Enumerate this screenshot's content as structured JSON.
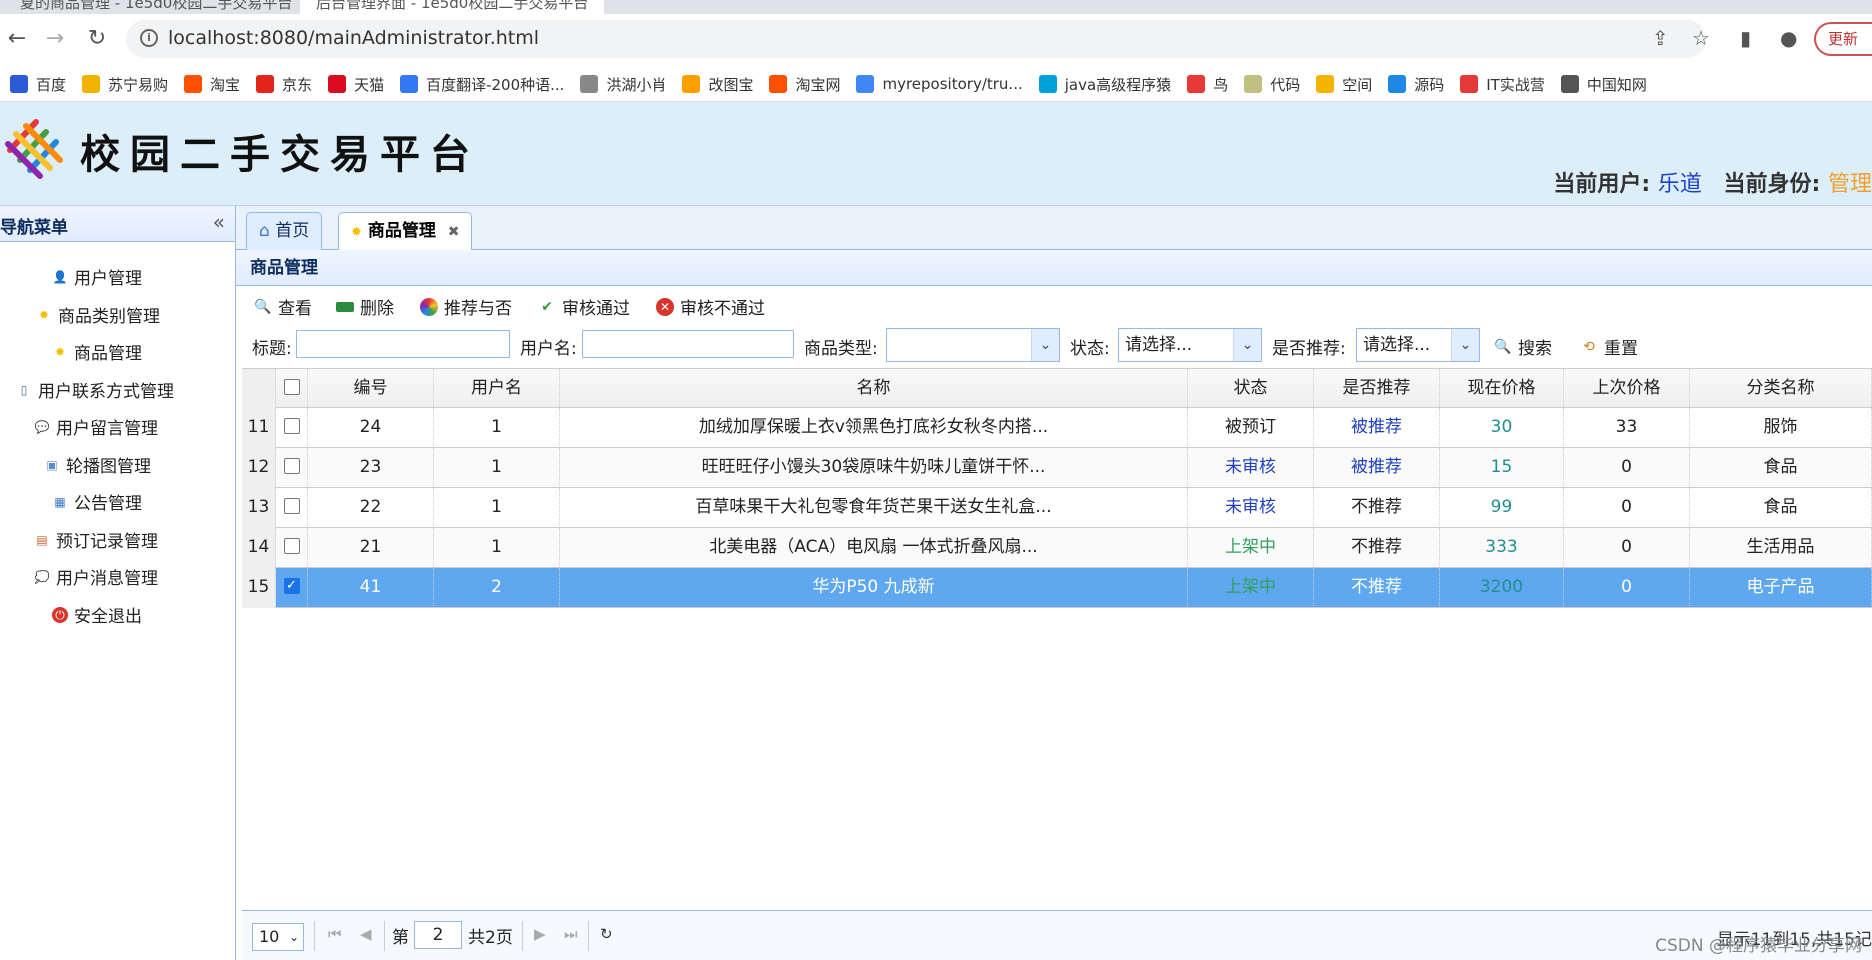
{
  "browser": {
    "tabs": [
      {
        "label": "夏的商品管理 - 1e5d0校园二手交易平台"
      },
      {
        "label": "后台管理界面 - 1e5d0校园二手交易平台"
      }
    ],
    "url": "localhost:8080/mainAdministrator.html",
    "update_label": "更新",
    "bookmarks": [
      {
        "label": "百度",
        "color": "#2b5bd7"
      },
      {
        "label": "苏宁易购",
        "color": "#f0b400"
      },
      {
        "label": "淘宝",
        "color": "#ff5000"
      },
      {
        "label": "京东",
        "color": "#e1251b"
      },
      {
        "label": "天猫",
        "color": "#d90d1f"
      },
      {
        "label": "百度翻译-200种语...",
        "color": "#3478f6"
      },
      {
        "label": "洪湖小肖",
        "color": "#888888"
      },
      {
        "label": "改图宝",
        "color": "#ffa000"
      },
      {
        "label": "淘宝网",
        "color": "#ff5000"
      },
      {
        "label": "myrepository/tru...",
        "color": "#4285f4"
      },
      {
        "label": "java高级程序猿",
        "color": "#00a1d6"
      },
      {
        "label": "鸟",
        "color": "#e53935"
      },
      {
        "label": "代码",
        "color": "#c0c080"
      },
      {
        "label": "空间",
        "color": "#f4b400"
      },
      {
        "label": "源码",
        "color": "#1e88e5"
      },
      {
        "label": "IT实战营",
        "color": "#e53935"
      },
      {
        "label": "中国知网",
        "color": "#555555"
      }
    ]
  },
  "header": {
    "title": "校园二手交易平台",
    "user_label": "当前用户:",
    "user_name": "乐道",
    "role_label": "当前身份:",
    "role_value": "管理"
  },
  "sidebar": {
    "title": "导航菜单",
    "items": [
      {
        "label": "用户管理",
        "icon": "user-icon"
      },
      {
        "label": "商品类别管理",
        "icon": "star-icon"
      },
      {
        "label": "商品管理",
        "icon": "star-icon"
      },
      {
        "label": "用户联系方式管理",
        "icon": "phone-icon"
      },
      {
        "label": "用户留言管理",
        "icon": "message-icon"
      },
      {
        "label": "轮播图管理",
        "icon": "images-icon"
      },
      {
        "label": "公告管理",
        "icon": "notice-icon"
      },
      {
        "label": "预订记录管理",
        "icon": "record-icon"
      },
      {
        "label": "用户消息管理",
        "icon": "chat-icon"
      },
      {
        "label": "安全退出",
        "icon": "power-icon"
      }
    ]
  },
  "tabs": [
    {
      "label": "首页"
    },
    {
      "label": "商品管理"
    }
  ],
  "panel_title": "商品管理",
  "toolbar": {
    "view": "查看",
    "delete": "删除",
    "recommend": "推荐与否",
    "approve": "审核通过",
    "reject": "审核不通过"
  },
  "filters": {
    "title_label": "标题:",
    "username_label": "用户名:",
    "type_label": "商品类型:",
    "status_label": "状态:",
    "status_value": "请选择...",
    "recommend_label": "是否推荐:",
    "recommend_value": "请选择...",
    "search": "搜索",
    "reset": "重置"
  },
  "grid": {
    "columns": [
      "编号",
      "用户名",
      "名称",
      "状态",
      "是否推荐",
      "现在价格",
      "上次价格",
      "分类名称"
    ],
    "rows": [
      {
        "num": "11",
        "id": "24",
        "user": "1",
        "name": "加绒加厚保暖上衣v领黑色打底衫女秋冬内搭...",
        "status": "被预订",
        "status_color": "#222222",
        "recommend": "被推荐",
        "rec_color": "#1f3fbf",
        "price": "30",
        "last": "33",
        "category": "服饰",
        "checked": false
      },
      {
        "num": "12",
        "id": "23",
        "user": "1",
        "name": "旺旺旺仔小馒头30袋原味牛奶味儿童饼干怀...",
        "status": "未审核",
        "status_color": "#1f3fbf",
        "recommend": "被推荐",
        "rec_color": "#1f3fbf",
        "price": "15",
        "last": "0",
        "category": "食品",
        "checked": false
      },
      {
        "num": "13",
        "id": "22",
        "user": "1",
        "name": "百草味果干大礼包零食年货芒果干送女生礼盒...",
        "status": "未审核",
        "status_color": "#1f3fbf",
        "recommend": "不推荐",
        "rec_color": "#222222",
        "price": "99",
        "last": "0",
        "category": "食品",
        "checked": false
      },
      {
        "num": "14",
        "id": "21",
        "user": "1",
        "name": "北美电器（ACA）电风扇 一体式折叠风扇...",
        "status": "上架中",
        "status_color": "#2f9f5f",
        "recommend": "不推荐",
        "rec_color": "#222222",
        "price": "333",
        "last": "0",
        "category": "生活用品",
        "checked": false
      },
      {
        "num": "15",
        "id": "41",
        "user": "2",
        "name": "华为P50 九成新",
        "status": "上架中",
        "status_color": "#2f9f5f",
        "recommend": "不推荐",
        "rec_color": "#ffffff",
        "price": "3200",
        "last": "0",
        "category": "电子产品",
        "checked": true
      }
    ]
  },
  "pager": {
    "page_size": "10",
    "page_prefix": "第",
    "page_value": "2",
    "page_suffix": "共2页",
    "info": "显示11到15,共15记"
  },
  "watermark": "CSDN @程序猿毕业分享网"
}
